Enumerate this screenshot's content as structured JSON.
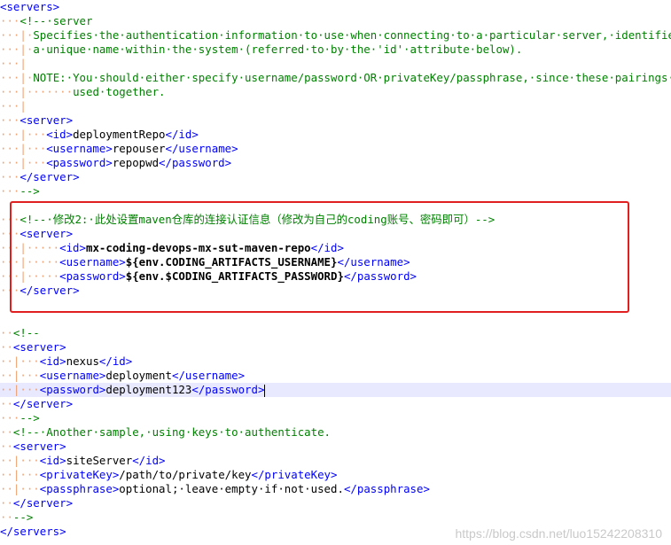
{
  "editor": {
    "lines": [
      {
        "ws": "",
        "segs": [
          {
            "c": "tag",
            "t": "<servers>"
          }
        ]
      },
      {
        "ws": "···",
        "segs": [
          {
            "c": "cmt",
            "t": "<!--·server"
          }
        ]
      },
      {
        "ws": "···|·",
        "segs": [
          {
            "c": "cmt",
            "t": "Specifies·the·authentication·information·to·use·when·connecting·to·a·particular·server,·identified·by"
          }
        ]
      },
      {
        "ws": "···|·",
        "segs": [
          {
            "c": "cmt",
            "t": "a·unique·name·within·the·system·(referred·to·by·the·'id'·attribute·below)."
          }
        ]
      },
      {
        "ws": "···|",
        "segs": []
      },
      {
        "ws": "···|·",
        "segs": [
          {
            "c": "cmt",
            "t": "NOTE:·You·should·either·specify·username/password·OR·privateKey/passphrase,·since·these·pairings·are"
          }
        ]
      },
      {
        "ws": "···|·······",
        "segs": [
          {
            "c": "cmt",
            "t": "used·together."
          }
        ]
      },
      {
        "ws": "···|",
        "segs": []
      },
      {
        "ws": "···",
        "segs": [
          {
            "c": "tag",
            "t": "<server>"
          }
        ]
      },
      {
        "ws": "···|···",
        "segs": [
          {
            "c": "tag",
            "t": "<id>"
          },
          {
            "c": "txt",
            "t": "deploymentRepo"
          },
          {
            "c": "tag",
            "t": "</id>"
          }
        ]
      },
      {
        "ws": "···|···",
        "segs": [
          {
            "c": "tag",
            "t": "<username>"
          },
          {
            "c": "txt",
            "t": "repouser"
          },
          {
            "c": "tag",
            "t": "</username>"
          }
        ]
      },
      {
        "ws": "···|···",
        "segs": [
          {
            "c": "tag",
            "t": "<password>"
          },
          {
            "c": "txt",
            "t": "repopwd"
          },
          {
            "c": "tag",
            "t": "</password>"
          }
        ]
      },
      {
        "ws": "···",
        "segs": [
          {
            "c": "tag",
            "t": "</server>"
          }
        ]
      },
      {
        "ws": "···",
        "segs": [
          {
            "c": "cmt",
            "t": "-->"
          }
        ]
      },
      {
        "ws": "",
        "segs": []
      },
      {
        "ws": "···",
        "segs": [
          {
            "c": "cmt",
            "t": "<!--·修改2:·此处设置maven仓库的连接认证信息（修改为自己的coding账号、密码即可）-->"
          }
        ]
      },
      {
        "ws": "···",
        "segs": [
          {
            "c": "tag",
            "t": "<server>"
          }
        ]
      },
      {
        "ws": "···|·····",
        "segs": [
          {
            "c": "tag",
            "t": "<id>"
          },
          {
            "c": "txt bold",
            "t": "mx-coding-devops-mx-sut-maven-repo"
          },
          {
            "c": "tag",
            "t": "</id>"
          }
        ]
      },
      {
        "ws": "···|·····",
        "segs": [
          {
            "c": "tag",
            "t": "<username>"
          },
          {
            "c": "txt bold",
            "t": "${env.CODING_ARTIFACTS_USERNAME}"
          },
          {
            "c": "tag",
            "t": "</username>"
          }
        ]
      },
      {
        "ws": "···|·····",
        "segs": [
          {
            "c": "tag",
            "t": "<password>"
          },
          {
            "c": "txt bold",
            "t": "${env.$CODING_ARTIFACTS_PASSWORD}"
          },
          {
            "c": "tag",
            "t": "</password>"
          }
        ]
      },
      {
        "ws": "···",
        "segs": [
          {
            "c": "tag",
            "t": "</server>"
          }
        ]
      },
      {
        "ws": "",
        "segs": []
      },
      {
        "ws": "",
        "segs": []
      },
      {
        "ws": "··",
        "segs": [
          {
            "c": "cmt",
            "t": "<!--"
          }
        ]
      },
      {
        "ws": "··",
        "segs": [
          {
            "c": "tag",
            "t": "<server>"
          }
        ]
      },
      {
        "ws": "··|···",
        "segs": [
          {
            "c": "tag",
            "t": "<id>"
          },
          {
            "c": "txt",
            "t": "nexus"
          },
          {
            "c": "tag",
            "t": "</id>"
          }
        ]
      },
      {
        "ws": "··|···",
        "segs": [
          {
            "c": "tag",
            "t": "<username>"
          },
          {
            "c": "txt",
            "t": "deployment"
          },
          {
            "c": "tag",
            "t": "</username>"
          }
        ]
      },
      {
        "ws": "··|···",
        "segs": [
          {
            "c": "tag",
            "t": "<password>"
          },
          {
            "c": "txt",
            "t": "deployment123"
          },
          {
            "c": "tag",
            "t": "</password>"
          }
        ],
        "active": true
      },
      {
        "ws": "··",
        "segs": [
          {
            "c": "tag",
            "t": "</server>"
          }
        ]
      },
      {
        "ws": "···",
        "segs": [
          {
            "c": "cmt",
            "t": "-->"
          }
        ]
      },
      {
        "ws": "··",
        "segs": [
          {
            "c": "cmt",
            "t": "<!--·Another·sample,·using·keys·to·authenticate."
          }
        ]
      },
      {
        "ws": "··",
        "segs": [
          {
            "c": "tag",
            "t": "<server>"
          }
        ]
      },
      {
        "ws": "··|···",
        "segs": [
          {
            "c": "tag",
            "t": "<id>"
          },
          {
            "c": "txt",
            "t": "siteServer"
          },
          {
            "c": "tag",
            "t": "</id>"
          }
        ]
      },
      {
        "ws": "··|···",
        "segs": [
          {
            "c": "tag",
            "t": "<privateKey>"
          },
          {
            "c": "txt",
            "t": "/path/to/private/key"
          },
          {
            "c": "tag",
            "t": "</privateKey>"
          }
        ]
      },
      {
        "ws": "··|···",
        "segs": [
          {
            "c": "tag",
            "t": "<passphrase>"
          },
          {
            "c": "txt",
            "t": "optional;·leave·empty·if·not·used."
          },
          {
            "c": "tag",
            "t": "</passphrase>"
          }
        ]
      },
      {
        "ws": "··",
        "segs": [
          {
            "c": "tag",
            "t": "</server>"
          }
        ]
      },
      {
        "ws": "··",
        "segs": [
          {
            "c": "cmt",
            "t": "-->"
          }
        ]
      },
      {
        "ws": "",
        "segs": [
          {
            "c": "tag",
            "t": "</servers>"
          }
        ]
      }
    ]
  },
  "annotation": {
    "color": "#e02020"
  },
  "watermark": "https://blog.csdn.net/luo15242208310"
}
